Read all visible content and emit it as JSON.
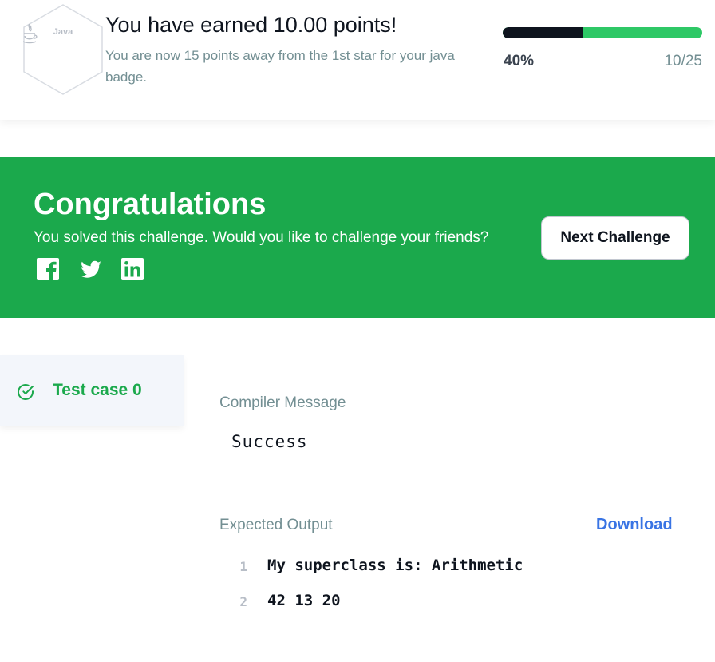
{
  "badge": {
    "language": "Java",
    "icon": "java-icon",
    "colors": {
      "hex_fill": "#ffffff",
      "hex_border": "#d8dce2"
    }
  },
  "points": {
    "title": "You have earned 10.00 points!",
    "subtitle": "You are now 15 points away from the 1st star for your java badge.",
    "progress_percent": "40%",
    "progress_count": "10/25",
    "progress_value": 0.4,
    "colors": {
      "fill": "#0e141e",
      "track": "#2ec866"
    }
  },
  "congrats": {
    "title": "Congratulations",
    "message": "You solved this challenge. Would you like to challenge your friends?",
    "next_button_label": "Next Challenge",
    "social_icons": [
      "facebook-icon",
      "twitter-icon",
      "linkedin-icon"
    ],
    "colors": {
      "background": "#1ba94c"
    }
  },
  "test_case": {
    "label": "Test case 0",
    "status_icon": "check-circle-icon",
    "colors": {
      "accent": "#1ba94c"
    }
  },
  "compiler": {
    "label": "Compiler Message",
    "message": "Success"
  },
  "expected_output": {
    "label": "Expected Output",
    "download_label": "Download",
    "lines": [
      {
        "number": "1",
        "text": "My superclass is: Arithmetic"
      },
      {
        "number": "2",
        "text": "42 13 20"
      }
    ],
    "colors": {
      "link": "#3974e4"
    }
  }
}
